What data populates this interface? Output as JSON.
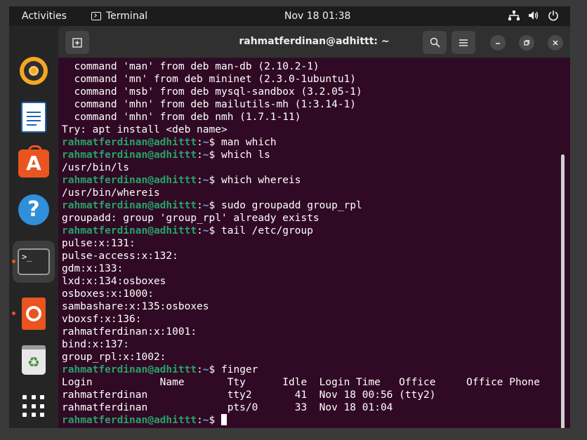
{
  "topbar": {
    "activities": "Activities",
    "app_name": "Terminal",
    "clock": "Nov 18  01:38"
  },
  "dock": {
    "items": [
      "rhythmbox",
      "libreoffice-writer",
      "ubuntu-software",
      "help",
      "terminal",
      "ubuntu-installer",
      "trash",
      "show-applications"
    ]
  },
  "window": {
    "title": "rahmatferdinan@adhittt: ~"
  },
  "prompt": {
    "user": "rahmatferdinan@adhittt",
    "sep": ":",
    "path": "~",
    "sigil": "$ "
  },
  "terminal": {
    "lines": [
      {
        "t": "  command 'man' from deb man-db (2.10.2-1)"
      },
      {
        "t": "  command 'mn' from deb mininet (2.3.0-1ubuntu1)"
      },
      {
        "t": "  command 'msb' from deb mysql-sandbox (3.2.05-1)"
      },
      {
        "t": "  command 'mhn' from deb mailutils-mh (1:3.14-1)"
      },
      {
        "t": "  command 'mhn' from deb nmh (1.7.1-11)"
      },
      {
        "t": "Try: apt install <deb name>"
      },
      {
        "p": true,
        "t": "man which"
      },
      {
        "p": true,
        "t": "which ls"
      },
      {
        "t": "/usr/bin/ls"
      },
      {
        "p": true,
        "t": "which whereis"
      },
      {
        "t": "/usr/bin/whereis"
      },
      {
        "p": true,
        "t": "sudo groupadd group_rpl"
      },
      {
        "t": "groupadd: group 'group_rpl' already exists"
      },
      {
        "p": true,
        "t": "tail /etc/group"
      },
      {
        "t": "pulse:x:131:"
      },
      {
        "t": "pulse-access:x:132:"
      },
      {
        "t": "gdm:x:133:"
      },
      {
        "t": "lxd:x:134:osboxes"
      },
      {
        "t": "osboxes:x:1000:"
      },
      {
        "t": "sambashare:x:135:osboxes"
      },
      {
        "t": "vboxsf:x:136:"
      },
      {
        "t": "rahmatferdinan:x:1001:"
      },
      {
        "t": "bind:x:137:"
      },
      {
        "t": "group_rpl:x:1002:"
      },
      {
        "p": true,
        "t": "finger"
      },
      {
        "t": "Login           Name       Tty      Idle  Login Time   Office     Office Phone"
      },
      {
        "t": "rahmatferdinan             tty2       41  Nov 18 00:56 (tty2)"
      },
      {
        "t": "rahmatferdinan             pts/0      33  Nov 18 01:04"
      },
      {
        "p": true,
        "t": "",
        "cursor": true
      }
    ]
  },
  "colors": {
    "terminal_bg": "#300a24",
    "prompt_user": "#26a269",
    "prompt_path": "#6aa2d8",
    "accent": "#e95420"
  }
}
